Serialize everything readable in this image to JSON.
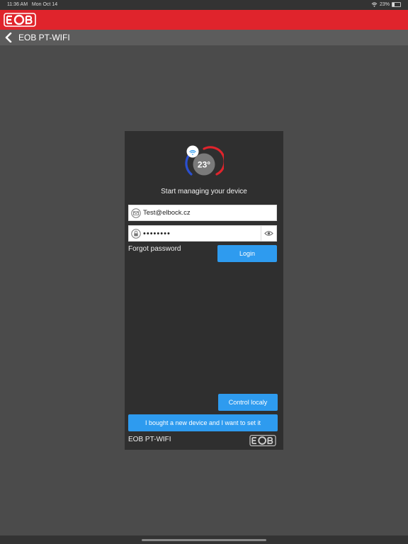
{
  "status_bar": {
    "time": "11:36 AM",
    "date": "Mon Oct 14",
    "battery": "23%",
    "icons": [
      "wifi-icon",
      "battery-icon"
    ]
  },
  "brand": {
    "logo_text": "EOB",
    "color": "#e0242c"
  },
  "nav": {
    "back_icon": "chevron-left-icon",
    "title": "EOB PT-WIFI"
  },
  "card": {
    "thermostat": {
      "temperature": "23°",
      "icon": "thermostat-icon",
      "wifi_icon": "cloud-wifi-icon"
    },
    "title": "Start managing your device",
    "email": {
      "value": "Test@elbock.cz",
      "placeholder": "",
      "icon": "envelope-icon"
    },
    "password": {
      "value": "••••••••",
      "placeholder": "",
      "icon": "lock-icon",
      "toggle_icon": "eye-icon"
    },
    "forgot_password": "Forgot password",
    "login_button": "Login",
    "control_locally_button": "Control localy",
    "new_device_button": "I bought a new device and I want to set it",
    "footer_name": "EOB PT-WIFI",
    "footer_logo": "EOB"
  },
  "colors": {
    "accent": "#2e9bef",
    "brand_red": "#e0242c",
    "background": "#4b4b4b",
    "card": "#2f2f2f"
  }
}
